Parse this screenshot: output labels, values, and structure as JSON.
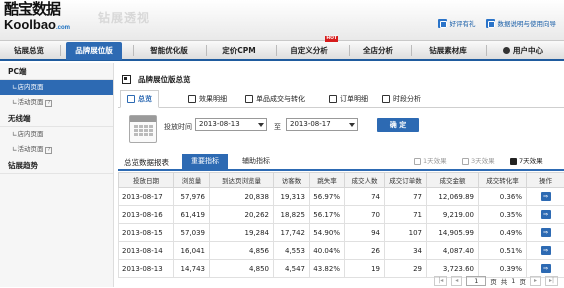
{
  "header": {
    "logo_cn": "酷宝数据",
    "logo_en": "Koolbao",
    "logo_com": ".com",
    "product": "钻展透视",
    "links": [
      {
        "label": "好评有礼",
        "icon": "gift-icon"
      },
      {
        "label": "数据说明与使用向导",
        "icon": "help-guide-icon"
      }
    ]
  },
  "nav": {
    "items": [
      "钻展总览",
      "品牌展位版",
      "智能优化版",
      "定价CPM",
      "自定义分析",
      "全店分析",
      "钻展素材库"
    ],
    "active": "品牌展位版",
    "hot_badge": "HOT",
    "user_center": "用户中心"
  },
  "sidebar": {
    "sections": [
      {
        "title": "PC端",
        "items": [
          "店内页面",
          "活动页面"
        ]
      },
      {
        "title": "无线端",
        "items": [
          "店内页面",
          "活动页面"
        ]
      },
      {
        "title": "钻展趋势",
        "items": []
      }
    ],
    "help_mark": "?"
  },
  "page": {
    "title": "品牌展位版总览",
    "tabs": [
      "总览",
      "效果明细",
      "单品成交与转化",
      "订单明细",
      "时段分析"
    ],
    "date_label": "投放时间",
    "date_from": "2013-08-13",
    "date_sep": "至",
    "date_to": "2013-08-17",
    "confirm": "确 定"
  },
  "report": {
    "title": "总览数据报表",
    "tab_primary": "重要指标",
    "tab_secondary": "辅助指标",
    "effects": [
      {
        "label": "1天效果",
        "active": false
      },
      {
        "label": "3天效果",
        "active": false
      },
      {
        "label": "7天效果",
        "active": true
      }
    ],
    "columns": [
      "投放日期",
      "浏览量",
      "到达页浏览量",
      "访客数",
      "跳失率",
      "成交人数",
      "成交订单数",
      "成交金额",
      "成交转化率",
      "操作"
    ],
    "rows": [
      [
        "2013-08-17",
        "57,976",
        "20,838",
        "19,313",
        "56.97%",
        "74",
        "77",
        "12,069.89",
        "0.36%"
      ],
      [
        "2013-08-16",
        "61,419",
        "20,262",
        "18,825",
        "56.17%",
        "70",
        "71",
        "9,219.00",
        "0.35%"
      ],
      [
        "2013-08-15",
        "57,039",
        "19,284",
        "17,742",
        "54.90%",
        "94",
        "107",
        "14,905.99",
        "0.49%"
      ],
      [
        "2013-08-14",
        "16,041",
        "4,856",
        "4,553",
        "40.04%",
        "26",
        "34",
        "4,087.40",
        "0.51%"
      ],
      [
        "2013-08-13",
        "14,743",
        "4,850",
        "4,547",
        "43.82%",
        "19",
        "29",
        "3,723.60",
        "0.39%"
      ]
    ],
    "pager": {
      "page": "1",
      "page_label": "页",
      "total_prefix": "共",
      "total_pages": "1",
      "total_suffix": "页"
    }
  }
}
